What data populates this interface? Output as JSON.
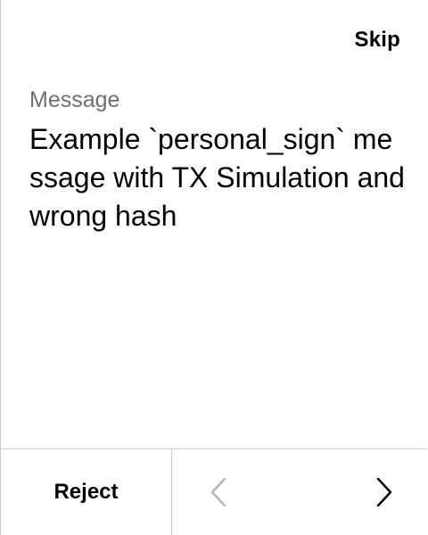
{
  "header": {
    "skip_label": "Skip"
  },
  "message": {
    "label": "Message",
    "text": "Example `personal_sign` message with TX Simulation and wrong hash"
  },
  "footer": {
    "reject_label": "Reject",
    "prev_icon": "chevron-left-icon",
    "next_icon": "chevron-right-icon",
    "prev_enabled": false,
    "next_enabled": true
  },
  "colors": {
    "background": "#ffffff",
    "text": "#000000",
    "label": "#6f6f6f",
    "divider": "#cfcfcf",
    "disabled_icon": "#b5b5b5"
  }
}
